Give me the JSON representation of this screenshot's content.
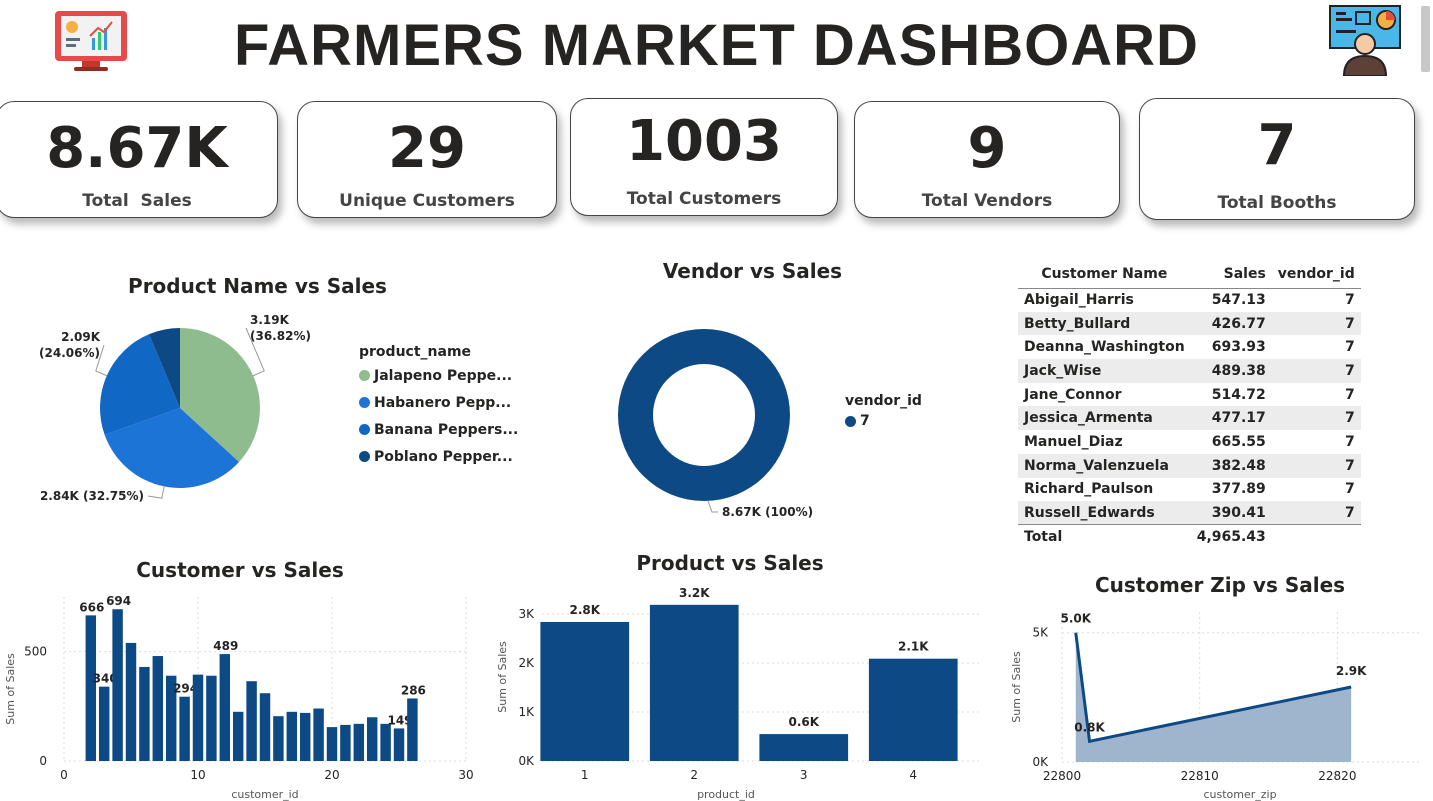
{
  "header": {
    "title": "FARMERS MARKET DASHBOARD",
    "left_icon": "monitor-dashboard-icon",
    "right_icon": "presenter-chart-icon"
  },
  "kpis": [
    {
      "value": "8.67K",
      "label": "Total  Sales"
    },
    {
      "value": "29",
      "label": "Unique Customers"
    },
    {
      "value": "1003",
      "label": "Total Customers"
    },
    {
      "value": "9",
      "label": "Total Vendors"
    },
    {
      "value": "7",
      "label": "Total Booths"
    }
  ],
  "colors": {
    "navy": "#0d4a85",
    "blue": "#1c74d6",
    "mid_blue": "#1168c4",
    "green": "#8fbc8f",
    "area": "#9fb4cd"
  },
  "chart_data": [
    {
      "id": "product_pie",
      "type": "pie",
      "title": "Product Name vs Sales",
      "legend_title": "product_name",
      "legend_position": "right",
      "slices": [
        {
          "name": "Jalapeno Peppe...",
          "value": 3.19,
          "label": "3.19K",
          "percent": "(36.82%)",
          "color": "#8fbc8f"
        },
        {
          "name": "Habanero Pepp...",
          "value": 2.84,
          "label": "2.84K (32.75%)",
          "percent": "",
          "color": "#1c74d6"
        },
        {
          "name": "Banana Peppers...",
          "value": 2.09,
          "label": "2.09K",
          "percent": "(24.06%)",
          "color": "#1168c4"
        },
        {
          "name": "Poblano Pepper...",
          "value": 0.55,
          "label": "",
          "percent": "",
          "color": "#0d4a85"
        }
      ]
    },
    {
      "id": "vendor_donut",
      "type": "pie",
      "title": "Vendor vs Sales",
      "legend_title": "vendor_id",
      "legend_position": "right",
      "slices": [
        {
          "name": "7",
          "value": 8.67,
          "label": "8.67K (100%)",
          "color": "#0d4a85"
        }
      ]
    },
    {
      "id": "customer_bar",
      "type": "bar",
      "title": "Customer vs Sales",
      "xlabel": "customer_id",
      "ylabel": "Sum of Sales",
      "xlim": [
        0,
        30
      ],
      "ylim": [
        0,
        750
      ],
      "x_ticks": [
        0,
        10,
        20,
        30
      ],
      "y_ticks": [
        0,
        500
      ],
      "x": [
        2,
        3,
        4,
        5,
        6,
        7,
        8,
        9,
        10,
        11,
        12,
        13,
        14,
        15,
        16,
        17,
        18,
        19,
        20,
        21,
        22,
        23,
        24,
        25,
        26
      ],
      "values": [
        666,
        340,
        694,
        540,
        430,
        480,
        390,
        294,
        395,
        390,
        489,
        225,
        365,
        310,
        205,
        225,
        220,
        240,
        155,
        165,
        170,
        200,
        170,
        149,
        286
      ],
      "data_labels": {
        "2": "666",
        "3": "340",
        "4": "694",
        "9": "294",
        "12": "489",
        "25": "149",
        "26": "286"
      }
    },
    {
      "id": "product_bar",
      "type": "bar",
      "title": "Product vs Sales",
      "xlabel": "product_id",
      "ylabel": "Sum of Sales",
      "categories": [
        "1",
        "2",
        "3",
        "4"
      ],
      "values": [
        2840,
        3190,
        550,
        2090
      ],
      "value_labels": [
        "2.8K",
        "3.2K",
        "0.6K",
        "2.1K"
      ],
      "ylim": [
        0,
        3350
      ],
      "y_ticks": [
        "0K",
        "1K",
        "2K",
        "3K"
      ]
    },
    {
      "id": "zip_area",
      "type": "area",
      "title": "Customer Zip vs Sales",
      "xlabel": "customer_zip",
      "ylabel": "Sum of Sales",
      "x": [
        22801,
        22802,
        22821
      ],
      "values": [
        5000,
        800,
        2900
      ],
      "value_labels": [
        "5.0K",
        "0.8K",
        "2.9K"
      ],
      "xlim": [
        22800,
        22826
      ],
      "ylim": [
        0,
        5800
      ],
      "x_ticks": [
        "22800",
        "22810",
        "22820"
      ],
      "y_ticks": [
        "0K",
        "5K"
      ]
    },
    {
      "id": "customer_table",
      "type": "table",
      "columns": [
        "Customer Name",
        "Sales",
        "vendor_id"
      ],
      "rows": [
        [
          "Abigail_Harris",
          "547.13",
          "7"
        ],
        [
          "Betty_Bullard",
          "426.77",
          "7"
        ],
        [
          "Deanna_Washington",
          "693.93",
          "7"
        ],
        [
          "Jack_Wise",
          "489.38",
          "7"
        ],
        [
          "Jane_Connor",
          "514.72",
          "7"
        ],
        [
          "Jessica_Armenta",
          "477.17",
          "7"
        ],
        [
          "Manuel_Diaz",
          "665.55",
          "7"
        ],
        [
          "Norma_Valenzuela",
          "382.48",
          "7"
        ],
        [
          "Richard_Paulson",
          "377.89",
          "7"
        ],
        [
          "Russell_Edwards",
          "390.41",
          "7"
        ]
      ],
      "total": [
        "Total",
        "4,965.43",
        ""
      ]
    }
  ]
}
